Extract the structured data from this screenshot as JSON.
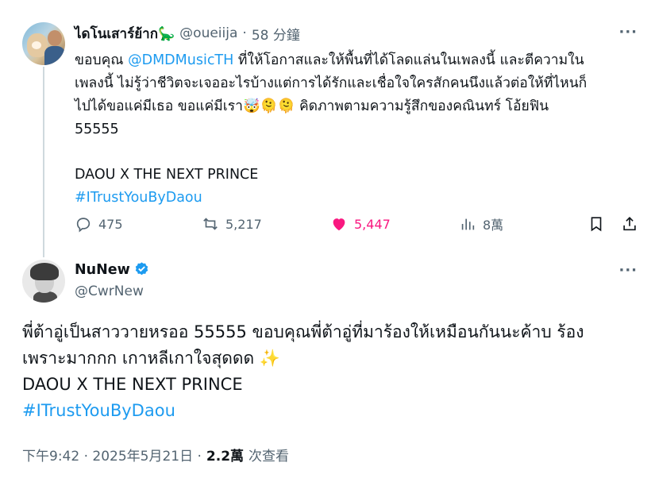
{
  "reply_tweet": {
    "display_name": "ไดโนเสาร์ย้าก🦕",
    "handle": "@oueiija",
    "separator": "·",
    "time_ago": "58 分鐘",
    "more_icon": "more-icon",
    "lines": [
      {
        "pre": "ขอบคุณ ",
        "link": "@DMDMusicTH",
        "post": " ที่ให้โอกาสและให้พื้นที่ได้โลดแล่นในเพลงนี้ และตีความใน"
      },
      {
        "text": "เพลงนี้ ไม่รู้ว่าชีวิตจะเจออะไรบ้างแต่การได้รักและเชื่อใจใครสักคนนึงแล้วต่อให้ที่ไหนก็"
      },
      {
        "text": "ไปได้ขอแค่มีเธอ ขอแค่มีเรา🤯🫠🫠 คิดภาพตามความรู้สึกของคณินทร์ โอ้ยฟิน"
      },
      {
        "text": "55555"
      }
    ],
    "title_line": "DAOU X THE NEXT PRINCE",
    "hashtag": "#ITrustYouByDaou",
    "actions": {
      "replies": "475",
      "reposts": "5,217",
      "likes": "5,447",
      "views": "8萬"
    },
    "like_color": "#f91880"
  },
  "main_tweet": {
    "display_name": "NuNew",
    "handle": "@CwrNew",
    "verified_color": "#1d9bf0",
    "lines": [
      "พี่ต้าอู่เป็นสาววายหรออ 55555 ขอบคุณพี่ต้าอู่ที่มาร้องให้เหมือนกันนะค้าบ ร้อง",
      "เพราะมากกก เกาหลีเกาใจสุดดด ✨",
      "DAOU X THE NEXT PRINCE"
    ],
    "hashtag": "#ITrustYouByDaou",
    "timestamp": "下午9:42 · 2025年5月21日 ·",
    "view_count": "2.2萬",
    "view_label": "次查看"
  },
  "colors": {
    "link": "#1d9bf0",
    "muted": "#536471",
    "text": "#0f1419"
  }
}
